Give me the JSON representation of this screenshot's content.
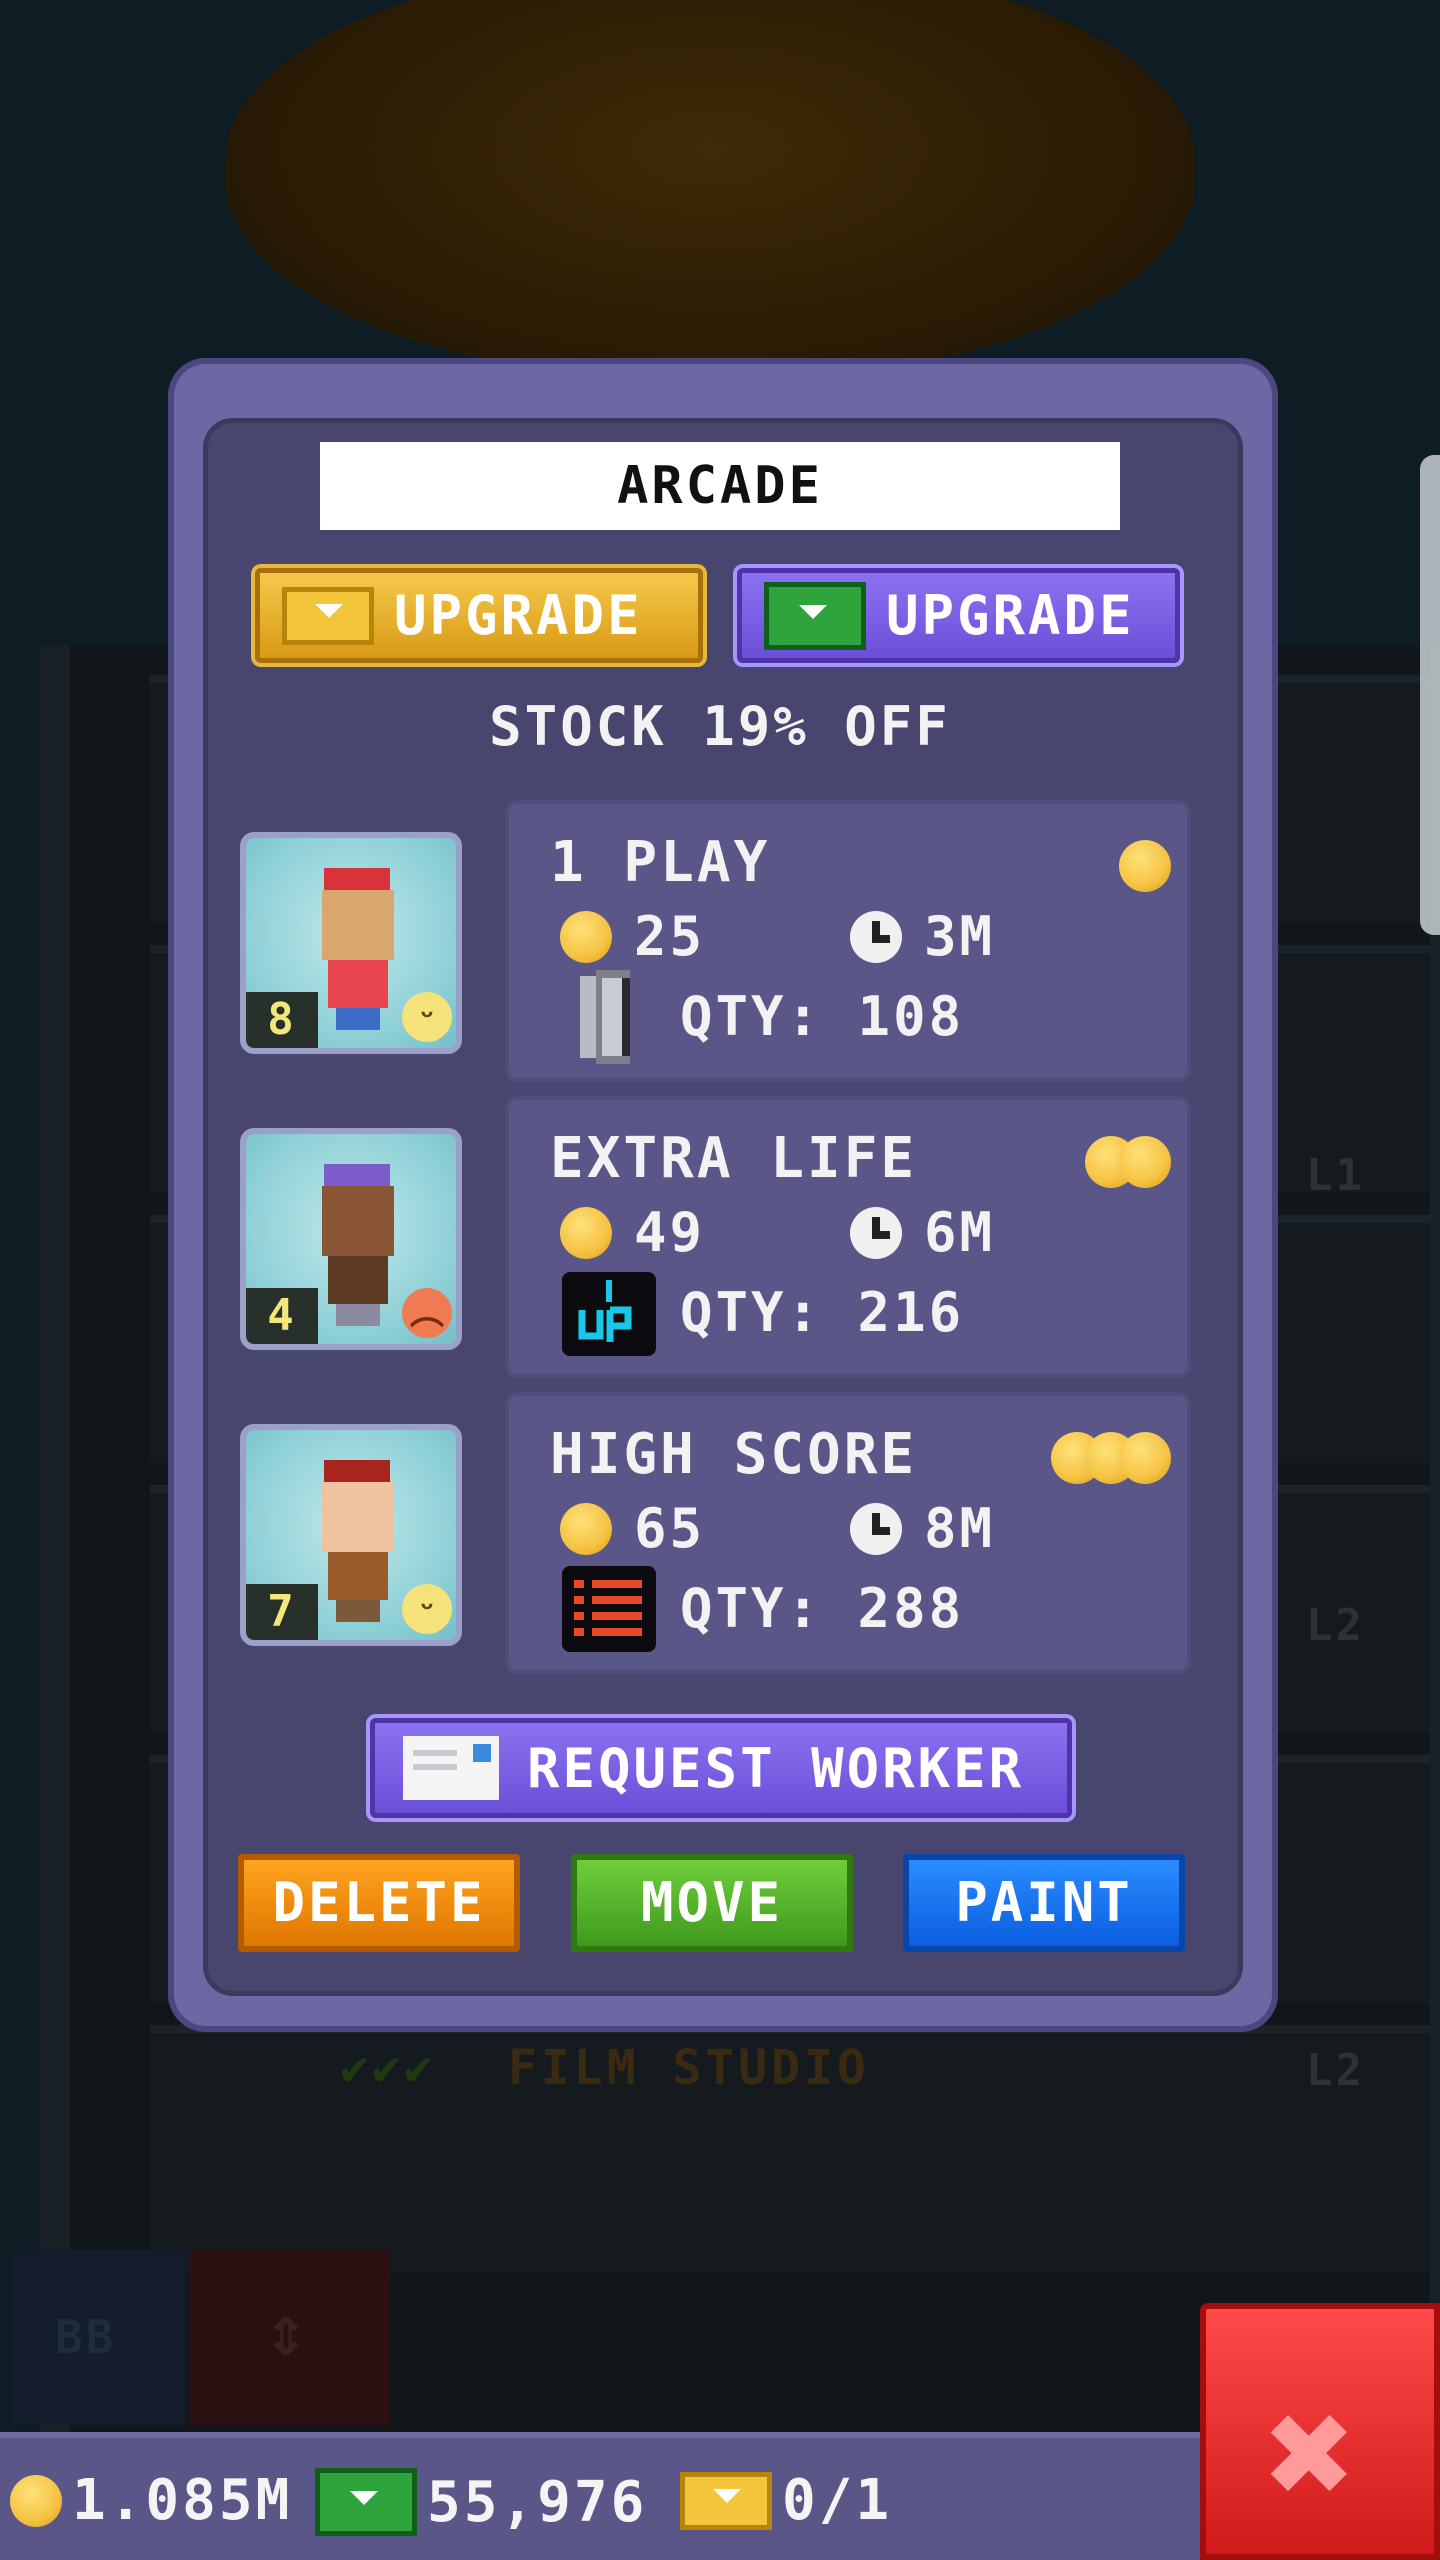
{
  "background": {
    "floor_label": "FILM STUDIO",
    "floor_checks": "✔✔✔",
    "level_labels": [
      "L1",
      "L2",
      "L2"
    ],
    "tile_label": "BB"
  },
  "dialog": {
    "title": "ARCADE",
    "upgrade_gold_label": "UPGRADE",
    "upgrade_bux_label": "UPGRADE",
    "stock_text": "STOCK 19% OFF",
    "products": [
      {
        "name": "1 PLAY",
        "price": "25",
        "time": "3M",
        "qty": "QTY: 108",
        "worker_level": "8",
        "mood": "happy",
        "coin_tier": 1,
        "qty_icon": "token-icon"
      },
      {
        "name": "EXTRA LIFE",
        "price": "49",
        "time": "6M",
        "qty": "QTY: 216",
        "worker_level": "4",
        "mood": "unhappy",
        "coin_tier": 2,
        "qty_icon": "one-up-icon"
      },
      {
        "name": "HIGH SCORE",
        "price": "65",
        "time": "8M",
        "qty": "QTY: 288",
        "worker_level": "7",
        "mood": "happy",
        "coin_tier": 3,
        "qty_icon": "scoreboard-icon"
      }
    ],
    "request_worker_label": "REQUEST WORKER",
    "actions": {
      "delete": "DELETE",
      "move": "MOVE",
      "paint": "PAINT"
    }
  },
  "status_bar": {
    "coins": "1.085M",
    "bux": "55,976",
    "tickets": "0/1"
  },
  "close_label": "✖",
  "colors": {
    "dialog_frame": "#6c68a4",
    "dialog_body": "#48466e",
    "gold": "#f5c242",
    "delete": "#ff8c00",
    "move": "#52b52a",
    "paint": "#1677f5",
    "close": "#e62a2a"
  }
}
